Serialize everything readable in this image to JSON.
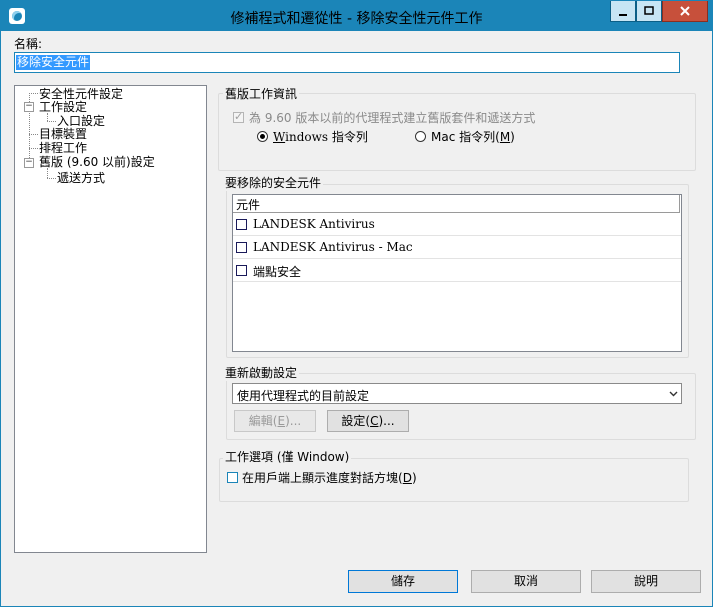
{
  "window": {
    "title": "修補程式和遷從性 - 移除安全性元件工作"
  },
  "name": {
    "label": "名稱:",
    "value": "移除安全元件"
  },
  "tree": {
    "items": [
      {
        "label": "安全性元件設定"
      },
      {
        "label": "工作設定"
      },
      {
        "label": "入口設定"
      },
      {
        "label": "目標裝置"
      },
      {
        "label": "排程工作"
      },
      {
        "label": "舊版 (9.60 以前)設定"
      },
      {
        "label": "遞送方式"
      }
    ]
  },
  "legacy": {
    "title": "舊版工作資訊",
    "create_label": "為 9.60 版本以前的代理程式建立舊版套件和遞送方式",
    "radio_windows": {
      "text": "indows 指令列",
      "mnemonic": "W"
    },
    "radio_mac": {
      "text_before": "Mac 指令列(",
      "mnemonic": "M",
      "text_after": ")"
    }
  },
  "components": {
    "title": "要移除的安全元件",
    "column_header": "元件",
    "rows": [
      {
        "label": "LANDESK Antivirus"
      },
      {
        "label": "LANDESK Antivirus - Mac"
      },
      {
        "label": "端點安全"
      }
    ]
  },
  "reboot": {
    "title": "重新啟動設定",
    "selected": "使用代理程式的目前設定",
    "edit_button": {
      "before": "編輯(",
      "mnemonic": "E",
      "after": ")..."
    },
    "settings_button": {
      "before": "設定(",
      "mnemonic": "C",
      "after": ")..."
    }
  },
  "task_options": {
    "title": "工作選項 (僅 Window)",
    "show_progress_label": {
      "before": "在用戶端上顯示進度對話方塊(",
      "mnemonic": "D",
      "after": ")"
    }
  },
  "footer": {
    "save": "儲存",
    "cancel": "取消",
    "help": "說明"
  },
  "colors": {
    "titlebar": "#1b85b8",
    "selection": "#3399ff",
    "close": "#c7503b"
  }
}
